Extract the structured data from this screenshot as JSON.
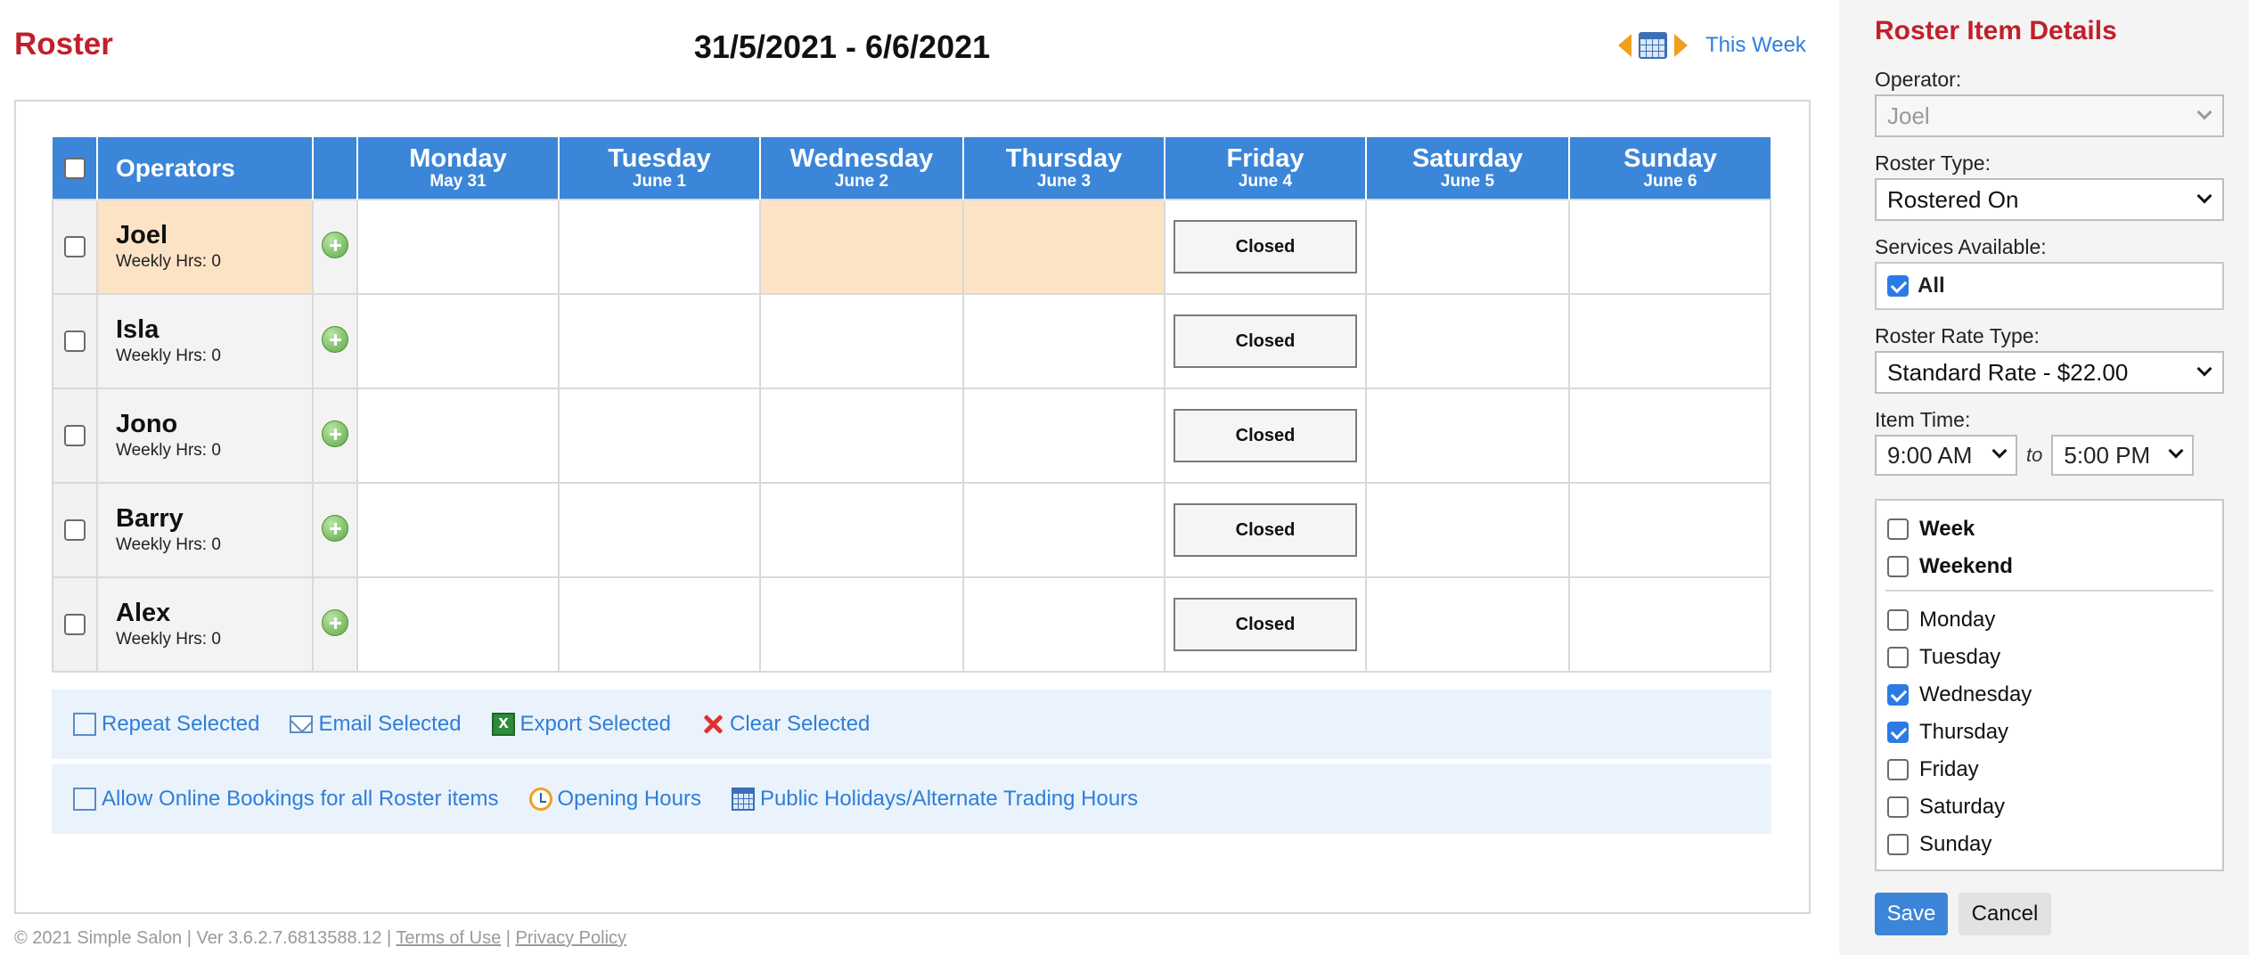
{
  "header": {
    "title": "Roster",
    "week_range": "31/5/2021 - 6/6/2021",
    "this_week_label": "This Week"
  },
  "table": {
    "operators_header": "Operators",
    "days": [
      {
        "name": "Monday",
        "date": "May 31"
      },
      {
        "name": "Tuesday",
        "date": "June 1"
      },
      {
        "name": "Wednesday",
        "date": "June 2"
      },
      {
        "name": "Thursday",
        "date": "June 3"
      },
      {
        "name": "Friday",
        "date": "June 4"
      },
      {
        "name": "Saturday",
        "date": "June 5"
      },
      {
        "name": "Sunday",
        "date": "June 6"
      }
    ],
    "rows": [
      {
        "name": "Joel",
        "hours": "Weekly Hrs: 0",
        "friday": "Closed"
      },
      {
        "name": "Isla",
        "hours": "Weekly Hrs: 0",
        "friday": "Closed"
      },
      {
        "name": "Jono",
        "hours": "Weekly Hrs: 0",
        "friday": "Closed"
      },
      {
        "name": "Barry",
        "hours": "Weekly Hrs: 0",
        "friday": "Closed"
      },
      {
        "name": "Alex",
        "hours": "Weekly Hrs: 0",
        "friday": "Closed"
      }
    ]
  },
  "actions": {
    "repeat": "Repeat Selected",
    "email": "Email Selected",
    "export": "Export Selected",
    "clear": "Clear Selected",
    "allow_online": "Allow Online Bookings for all Roster items",
    "opening_hours": "Opening Hours",
    "holidays": "Public Holidays/Alternate Trading Hours"
  },
  "footer": {
    "copyright": "© 2021 Simple Salon | Ver 3.6.2.7.6813588.12 |",
    "terms": "Terms of Use",
    "sep": "|",
    "privacy": "Privacy Policy"
  },
  "sidebar": {
    "title": "Roster Item Details",
    "operator_label": "Operator:",
    "operator_value": "Joel",
    "roster_type_label": "Roster Type:",
    "roster_type_value": "Rostered On",
    "services_label": "Services Available:",
    "services_all": "All",
    "rate_type_label": "Roster Rate Type:",
    "rate_type_value": "Standard Rate - $22.00",
    "item_time_label": "Item Time:",
    "time_from": "9:00 AM",
    "time_to_label": "to",
    "time_to": "5:00 PM",
    "week_label": "Week",
    "weekend_label": "Weekend",
    "days": [
      {
        "label": "Monday",
        "checked": false
      },
      {
        "label": "Tuesday",
        "checked": false
      },
      {
        "label": "Wednesday",
        "checked": true
      },
      {
        "label": "Thursday",
        "checked": true
      },
      {
        "label": "Friday",
        "checked": false
      },
      {
        "label": "Saturday",
        "checked": false
      },
      {
        "label": "Sunday",
        "checked": false
      }
    ],
    "save_label": "Save",
    "cancel_label": "Cancel"
  },
  "colors": {
    "accent": "#3b86d8",
    "brand_red": "#c0202a",
    "highlight": "#fde3c6"
  }
}
